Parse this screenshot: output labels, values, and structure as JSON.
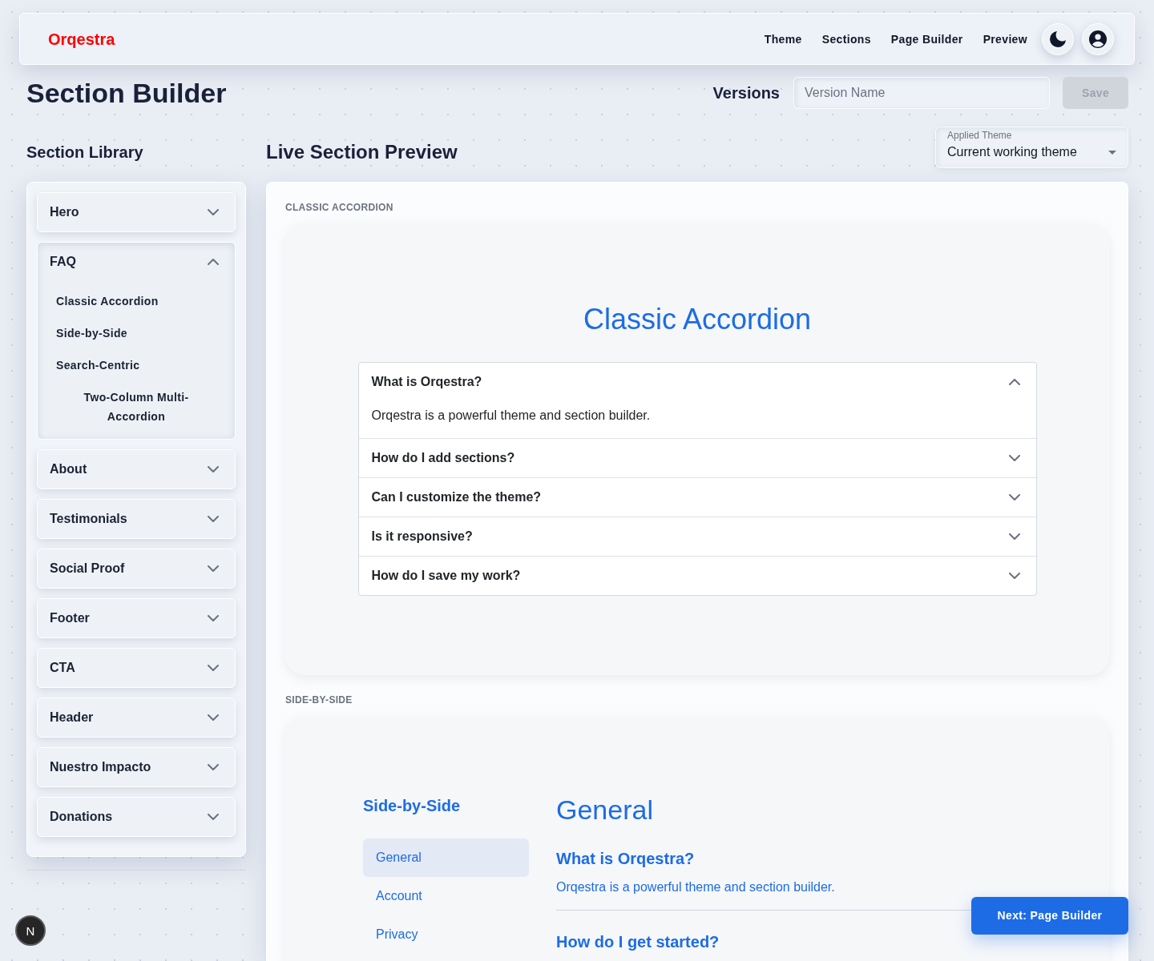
{
  "header": {
    "logo": "Orqestra",
    "nav": [
      {
        "label": "Theme"
      },
      {
        "label": "Sections"
      },
      {
        "label": "Page Builder"
      },
      {
        "label": "Preview"
      }
    ]
  },
  "page_title": "Section Builder",
  "versions": {
    "label": "Versions",
    "input": {
      "placeholder": "Version Name"
    },
    "save_button": {
      "label": "Save",
      "disabled": true
    }
  },
  "library": {
    "title": "Section Library",
    "items": [
      {
        "label": "Hero",
        "expanded": false
      },
      {
        "label": "FAQ",
        "expanded": true,
        "children": [
          {
            "label": "Classic Accordion"
          },
          {
            "label": "Side-by-Side"
          },
          {
            "label": "Search-Centric"
          },
          {
            "label": "Two-Column Multi-Accordion"
          }
        ]
      },
      {
        "label": "About",
        "expanded": false
      },
      {
        "label": "Testimonials",
        "expanded": false
      },
      {
        "label": "Social Proof",
        "expanded": false
      },
      {
        "label": "Footer",
        "expanded": false
      },
      {
        "label": "CTA",
        "expanded": false
      },
      {
        "label": "Header",
        "expanded": false
      },
      {
        "label": "Nuestro Impacto",
        "expanded": false
      },
      {
        "label": "Donations",
        "expanded": false
      }
    ]
  },
  "preview": {
    "title": "Live Section Preview",
    "theme_select": {
      "label": "Applied Theme",
      "value": "Current working theme"
    },
    "sections": [
      {
        "kind": "accordion",
        "caption": "CLASSIC ACCORDION",
        "title": "Classic Accordion",
        "items": [
          {
            "question": "What is Orqestra?",
            "answer": "Orqestra is a powerful theme and section builder.",
            "expanded": true
          },
          {
            "question": "How do I add sections?",
            "expanded": false
          },
          {
            "question": "Can I customize the theme?",
            "expanded": false
          },
          {
            "question": "Is it responsive?",
            "expanded": false
          },
          {
            "question": "How do I save my work?",
            "expanded": false
          }
        ]
      },
      {
        "kind": "side-by-side",
        "caption": "SIDE-BY-SIDE",
        "title": "Side-by-Side",
        "nav": [
          {
            "label": "General",
            "selected": true
          },
          {
            "label": "Account",
            "selected": false
          },
          {
            "label": "Privacy",
            "selected": false
          }
        ],
        "heading": "General",
        "faqs": [
          {
            "question": "What is Orqestra?",
            "answer": "Orqestra is a powerful theme and section builder."
          },
          {
            "question": "How do I get started?"
          }
        ]
      }
    ]
  },
  "next_button": {
    "label": "Next: Page Builder"
  },
  "dev_badge": {
    "label": "N"
  }
}
